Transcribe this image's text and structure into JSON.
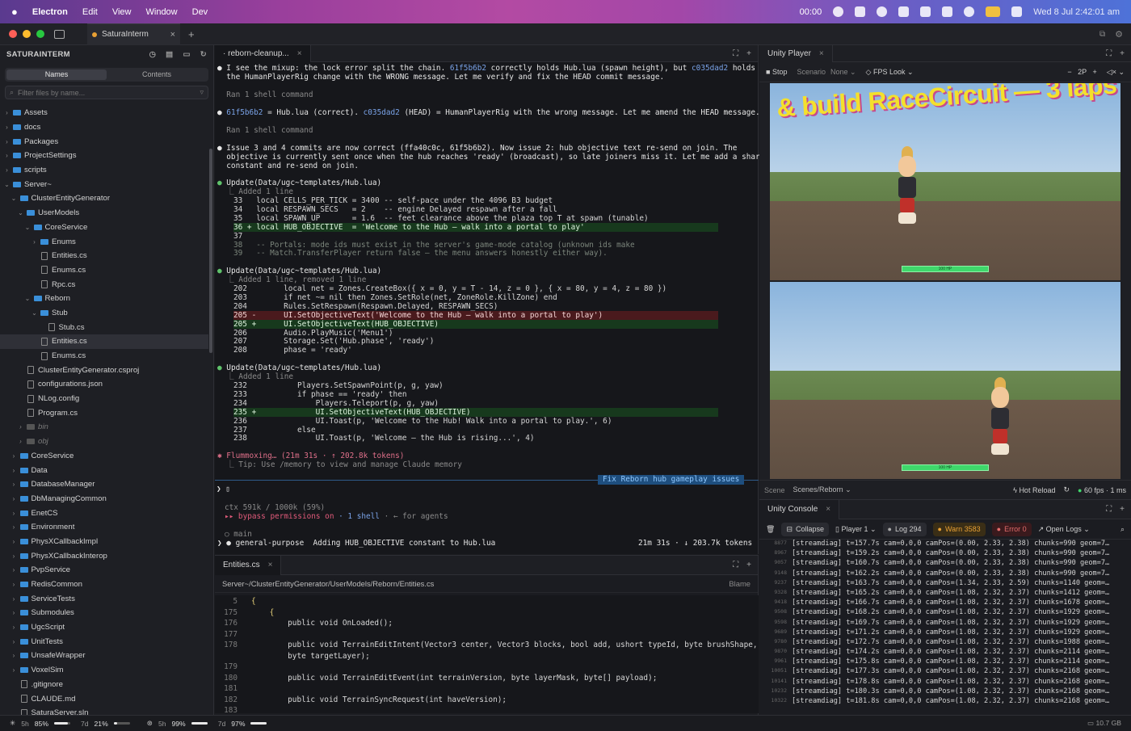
{
  "menubar": {
    "app": "Electron",
    "items": [
      "Edit",
      "View",
      "Window",
      "Dev"
    ],
    "clock_tab": "00:00",
    "datetime": "Wed 8 Jul  2:42:01 am"
  },
  "workspace_tab": "SaturaInterm",
  "sidebar": {
    "title": "SATURAINTERM",
    "seg_names": "Names",
    "seg_contents": "Contents",
    "filter_placeholder": "Filter files by name...",
    "rows": [
      {
        "label": "Assets",
        "indent": 0,
        "kind": "folder",
        "open": false
      },
      {
        "label": "docs",
        "indent": 0,
        "kind": "folder",
        "open": false
      },
      {
        "label": "Packages",
        "indent": 0,
        "kind": "folder",
        "open": false
      },
      {
        "label": "ProjectSettings",
        "indent": 0,
        "kind": "folder",
        "open": false
      },
      {
        "label": "scripts",
        "indent": 0,
        "kind": "folder",
        "open": false
      },
      {
        "label": "Server~",
        "indent": 0,
        "kind": "folder",
        "open": true
      },
      {
        "label": "ClusterEntityGenerator",
        "indent": 1,
        "kind": "folder",
        "open": true
      },
      {
        "label": "UserModels",
        "indent": 2,
        "kind": "folder",
        "open": true
      },
      {
        "label": "CoreService",
        "indent": 3,
        "kind": "folder",
        "open": true
      },
      {
        "label": "Enums",
        "indent": 4,
        "kind": "folder",
        "open": false
      },
      {
        "label": "Entities.cs",
        "indent": 4,
        "kind": "file"
      },
      {
        "label": "Enums.cs",
        "indent": 4,
        "kind": "file"
      },
      {
        "label": "Rpc.cs",
        "indent": 4,
        "kind": "file"
      },
      {
        "label": "Reborn",
        "indent": 3,
        "kind": "folder",
        "open": true
      },
      {
        "label": "Stub",
        "indent": 4,
        "kind": "folder",
        "open": true
      },
      {
        "label": "Stub.cs",
        "indent": 5,
        "kind": "file"
      },
      {
        "label": "Entities.cs",
        "indent": 4,
        "kind": "file",
        "selected": true
      },
      {
        "label": "Enums.cs",
        "indent": 4,
        "kind": "file"
      },
      {
        "label": "ClusterEntityGenerator.csproj",
        "indent": 2,
        "kind": "file"
      },
      {
        "label": "configurations.json",
        "indent": 2,
        "kind": "file"
      },
      {
        "label": "NLog.config",
        "indent": 2,
        "kind": "file"
      },
      {
        "label": "Program.cs",
        "indent": 2,
        "kind": "file"
      },
      {
        "label": "bin",
        "indent": 2,
        "kind": "folder",
        "open": false,
        "dim": true
      },
      {
        "label": "obj",
        "indent": 2,
        "kind": "folder",
        "open": false,
        "dim": true
      },
      {
        "label": "CoreService",
        "indent": 1,
        "kind": "folder",
        "open": false
      },
      {
        "label": "Data",
        "indent": 1,
        "kind": "folder",
        "open": false
      },
      {
        "label": "DatabaseManager",
        "indent": 1,
        "kind": "folder",
        "open": false
      },
      {
        "label": "DbManagingCommon",
        "indent": 1,
        "kind": "folder",
        "open": false
      },
      {
        "label": "EnetCS",
        "indent": 1,
        "kind": "folder",
        "open": false
      },
      {
        "label": "Environment",
        "indent": 1,
        "kind": "folder",
        "open": false
      },
      {
        "label": "PhysXCallbackImpl",
        "indent": 1,
        "kind": "folder",
        "open": false
      },
      {
        "label": "PhysXCallbackInterop",
        "indent": 1,
        "kind": "folder",
        "open": false
      },
      {
        "label": "PvpService",
        "indent": 1,
        "kind": "folder",
        "open": false
      },
      {
        "label": "RedisCommon",
        "indent": 1,
        "kind": "folder",
        "open": false
      },
      {
        "label": "ServiceTests",
        "indent": 1,
        "kind": "folder",
        "open": false
      },
      {
        "label": "Submodules",
        "indent": 1,
        "kind": "folder",
        "open": false
      },
      {
        "label": "UgcScript",
        "indent": 1,
        "kind": "folder",
        "open": false
      },
      {
        "label": "UnitTests",
        "indent": 1,
        "kind": "folder",
        "open": false
      },
      {
        "label": "UnsafeWrapper",
        "indent": 1,
        "kind": "folder",
        "open": false
      },
      {
        "label": "VoxelSim",
        "indent": 1,
        "kind": "folder",
        "open": false
      },
      {
        "label": ".gitignore",
        "indent": 1,
        "kind": "file"
      },
      {
        "label": "CLAUDE.md",
        "indent": 1,
        "kind": "file"
      },
      {
        "label": "SaturaServer.sln",
        "indent": 1,
        "kind": "file"
      }
    ]
  },
  "terminal": {
    "tab": "· reborn-cleanup...",
    "l1a": "● ",
    "l1b": "I see the mixup: the lock error split the chain. ",
    "l1c": "61f5b6b2",
    "l1d": " correctly holds Hub.lua (spawn height), but ",
    "l1e": "c035dad2",
    "l1f": " holds",
    "l2": "  the HumanPlayerRig change with the WRONG message. Let me verify and fix the HEAD commit message.",
    "ran1": "  Ran 1 shell command",
    "l3a": "● ",
    "l3b": "61f5b6b2",
    "l3c": " = Hub.lua (correct). ",
    "l3d": "c035dad2",
    "l3e": " (HEAD) = HumanPlayerRig with the wrong message. Let me amend the HEAD message.",
    "ran2": "  Ran 1 shell command",
    "l4": "● Issue 3 and 4 commits are now correct (ffa40c0c, 61f5b6b2). Now issue 2: hub objective text re-send on join. The",
    "l5": "  objective is currently sent once when the hub reaches 'ready' (broadcast), so late joiners miss it. Let me add a shared",
    "l6": "  constant and re-send on join.",
    "u1": "Update(Data/ugc~templates/Hub.lua)",
    "u1s": "  ⎿ Added 1 line",
    "d1": [
      "33   local CELLS_PER_TICK = 3400 -- self-pace under the 4096 B3 budget",
      "34   local RESPAWN_SECS   = 2    -- engine Delayed respawn after a fall",
      "35   local SPAWN_UP       = 1.6  -- feet clearance above the plaza top T at spawn (tunable)",
      "36 + local HUB_OBJECTIVE  = 'Welcome to the Hub — walk into a portal to play'",
      "37",
      "38   -- Portals: mode ids must exist in the server's game-mode catalog (unknown ids make",
      "39   -- Match.TransferPlayer return false — the menu answers honestly either way)."
    ],
    "u2": "Update(Data/ugc~templates/Hub.lua)",
    "u2s": "  ⎿ Added 1 line, removed 1 line",
    "d2": [
      "202        local net = Zones.CreateBox({ x = 0, y = T - 14, z = 0 }, { x = 80, y = 4, z = 80 })",
      "203        if net ~= nil then Zones.SetRole(net, ZoneRole.KillZone) end",
      "204        Rules.SetRespawn(Respawn.Delayed, RESPAWN_SECS)",
      "205 -      UI.SetObjectiveText('Welcome to the Hub — walk into a portal to play')",
      "205 +      UI.SetObjectiveText(HUB_OBJECTIVE)",
      "206        Audio.PlayMusic('Menu1')",
      "207        Storage.Set('Hub.phase', 'ready')",
      "208        phase = 'ready'"
    ],
    "u3": "Update(Data/ugc~templates/Hub.lua)",
    "u3s": "  ⎿ Added 1 line",
    "d3": [
      "232           Players.SetSpawnPoint(p, g, yaw)",
      "233           if phase == 'ready' then",
      "234               Players.Teleport(p, g, yaw)",
      "235 +             UI.SetObjectiveText(HUB_OBJECTIVE)",
      "236               UI.Toast(p, 'Welcome to the Hub! Walk into a portal to play.', 6)",
      "237           else",
      "238               UI.Toast(p, 'Welcome — the Hub is rising...', 4)"
    ],
    "flum": "✱ Flummoxing… (21m 31s · ↑ 202.8k tokens)",
    "tip": "  ⎿ Tip: Use /memory to view and manage Claude memory",
    "badge": "Fix Reborn hub gameplay issues",
    "prompt": "❯ ▯",
    "ctx": "ctx 591k / 1000k (59%)",
    "bypass": "▸▸ bypass permissions on",
    "shell": " · 1 shell",
    "agents": " · ← for agents",
    "branch": "○ main",
    "agent": "❯ ● general-purpose  Adding HUB_OBJECTIVE constant to Hub.lua",
    "timer": "21m 31s · ↓ 203.7k tokens"
  },
  "editor": {
    "tab": "Entities.cs",
    "path": "Server~/ClusterEntityGenerator/UserModels/Reborn/Entities.cs",
    "blame": "Blame",
    "lines": [
      {
        "n": "5",
        "t": "{"
      },
      {
        "n": "175",
        "t": "    {"
      },
      {
        "n": "176",
        "t": "        public void OnLoaded();"
      },
      {
        "n": "177",
        "t": ""
      },
      {
        "n": "178",
        "t": "        public void TerrainEditIntent(Vector3 center, Vector3 blocks, bool add, ushort typeId, byte brushShape,"
      },
      {
        "n": "",
        "t": "        byte targetLayer);"
      },
      {
        "n": "179",
        "t": ""
      },
      {
        "n": "180",
        "t": "        public void TerrainEditEvent(int terrainVersion, byte layerMask, byte[] payload);"
      },
      {
        "n": "181",
        "t": ""
      },
      {
        "n": "182",
        "t": "        public void TerrainSyncRequest(int haveVersion);"
      },
      {
        "n": "183",
        "t": ""
      }
    ]
  },
  "unity": {
    "tab": "Unity Player",
    "stop": "Stop",
    "scenario_label": "Scenario",
    "scenario": "None",
    "fps_look": "FPS Look",
    "player_count": "2P",
    "sign_text": "& build RaceCircuit — 3 laps",
    "hp_text": "100 HP",
    "scene_label": "Scene",
    "scene": "Scenes/Reborn",
    "hot_reload": "Hot Reload",
    "fps": "60 fps · 1 ms"
  },
  "console": {
    "tab": "Unity Console",
    "collapse": "Collapse",
    "player": "Player 1",
    "log": "Log 294",
    "warn": "Warn 3583",
    "error": "Error 0",
    "open_logs": "Open Logs",
    "rows": [
      {
        "n": "8877",
        "t": "[streamdiag] t=157.7s cam=0,0,0 camPos=(0.00, 2.33, 2.38) chunks=990 geom=7…"
      },
      {
        "n": "8967",
        "t": "[streamdiag] t=159.2s cam=0,0,0 camPos=(0.00, 2.33, 2.38) chunks=990 geom=7…"
      },
      {
        "n": "9057",
        "t": "[streamdiag] t=160.7s cam=0,0,0 camPos=(0.00, 2.33, 2.38) chunks=990 geom=7…"
      },
      {
        "n": "9148",
        "t": "[streamdiag] t=162.2s cam=0,0,0 camPos=(0.00, 2.33, 2.38) chunks=990 geom=7…"
      },
      {
        "n": "9237",
        "t": "[streamdiag] t=163.7s cam=0,0,0 camPos=(1.34, 2.33, 2.59) chunks=1140 geom=…"
      },
      {
        "n": "9328",
        "t": "[streamdiag] t=165.2s cam=0,0,0 camPos=(1.08, 2.32, 2.37) chunks=1412 geom=…"
      },
      {
        "n": "9418",
        "t": "[streamdiag] t=166.7s cam=0,0,0 camPos=(1.08, 2.32, 2.37) chunks=1678 geom=…"
      },
      {
        "n": "9508",
        "t": "[streamdiag] t=168.2s cam=0,0,0 camPos=(1.08, 2.32, 2.37) chunks=1929 geom=…"
      },
      {
        "n": "9598",
        "t": "[streamdiag] t=169.7s cam=0,0,0 camPos=(1.08, 2.32, 2.37) chunks=1929 geom=…"
      },
      {
        "n": "9689",
        "t": "[streamdiag] t=171.2s cam=0,0,0 camPos=(1.08, 2.32, 2.37) chunks=1929 geom=…"
      },
      {
        "n": "9780",
        "t": "[streamdiag] t=172.7s cam=0,0,0 camPos=(1.08, 2.32, 2.37) chunks=1988 geom=…"
      },
      {
        "n": "9870",
        "t": "[streamdiag] t=174.2s cam=0,0,0 camPos=(1.08, 2.32, 2.37) chunks=2114 geom=…"
      },
      {
        "n": "9961",
        "t": "[streamdiag] t=175.8s cam=0,0,0 camPos=(1.08, 2.32, 2.37) chunks=2114 geom=…"
      },
      {
        "n": "10051",
        "t": "[streamdiag] t=177.3s cam=0,0,0 camPos=(1.08, 2.32, 2.37) chunks=2168 geom=…"
      },
      {
        "n": "10141",
        "t": "[streamdiag] t=178.8s cam=0,0,0 camPos=(1.08, 2.32, 2.37) chunks=2168 geom=…"
      },
      {
        "n": "10232",
        "t": "[streamdiag] t=180.3s cam=0,0,0 camPos=(1.08, 2.32, 2.37) chunks=2168 geom=…"
      },
      {
        "n": "10322",
        "t": "[streamdiag] t=181.8s cam=0,0,0 camPos=(1.08, 2.32, 2.37) chunks=2168 geom=…"
      }
    ]
  },
  "status": {
    "a1": "5h",
    "a2": "85%",
    "a3": "7d",
    "a4": "21%",
    "b1": "5h",
    "b2": "99%",
    "b3": "7d",
    "b4": "97%",
    "mem": "10.7 GB",
    "usage": {
      "a_5h": 0.85,
      "a_7d": 0.21,
      "b_5h": 0.99,
      "b_7d": 0.97
    }
  },
  "colors": {
    "accent": "#3a8fd9",
    "add": "#17391d",
    "del": "#4a1a1d",
    "warn": "#e8a034",
    "error": "#e26b6b"
  }
}
